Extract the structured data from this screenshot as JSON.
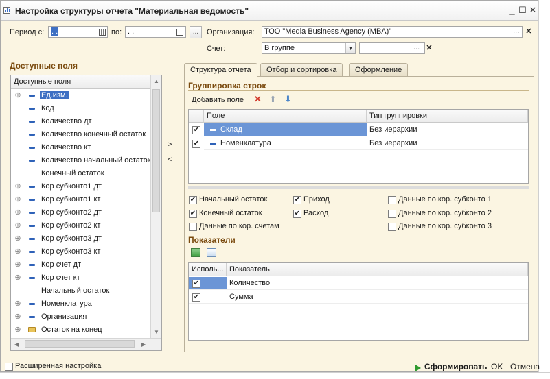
{
  "window": {
    "title": "Настройка структуры отчета \"Материальная ведомость\"",
    "minimize_glyph": "_",
    "maximize_glyph": "☐",
    "close_glyph": "✕"
  },
  "period": {
    "label": "Период с:",
    "from_value": " .  . ",
    "to_label": "по:",
    "to_value": " .  . ",
    "more_button": "..."
  },
  "organization": {
    "label": "Организация:",
    "value": "ТОО \"Media Business Agency (MBA)\"",
    "select_button": "...",
    "clear_glyph": "✕"
  },
  "account": {
    "label": "Счет:",
    "mode_value": "В группе",
    "value": "",
    "select_button": "...",
    "clear_glyph": "✕"
  },
  "available_fields": {
    "section_title": "Доступные поля",
    "column_header": "Доступные поля",
    "items": [
      {
        "label": "Ед.изм.",
        "expandable": true,
        "icon": "field-icon",
        "selected": true
      },
      {
        "label": "Код",
        "expandable": false,
        "icon": "field-icon",
        "selected": false
      },
      {
        "label": "Количество дт",
        "expandable": false,
        "icon": "field-icon",
        "selected": false
      },
      {
        "label": "Количество конечный остаток",
        "expandable": false,
        "icon": "field-icon",
        "selected": false
      },
      {
        "label": "Количество кт",
        "expandable": false,
        "icon": "field-icon",
        "selected": false
      },
      {
        "label": "Количество начальный остаток",
        "expandable": false,
        "icon": "field-icon",
        "selected": false
      },
      {
        "label": "Конечный остаток",
        "expandable": false,
        "icon": "none",
        "selected": false
      },
      {
        "label": "Кор субконто1 дт",
        "expandable": true,
        "icon": "field-icon",
        "selected": false
      },
      {
        "label": "Кор субконто1 кт",
        "expandable": true,
        "icon": "field-icon",
        "selected": false
      },
      {
        "label": "Кор субконто2 дт",
        "expandable": true,
        "icon": "field-icon",
        "selected": false
      },
      {
        "label": "Кор субконто2 кт",
        "expandable": true,
        "icon": "field-icon",
        "selected": false
      },
      {
        "label": "Кор субконто3 дт",
        "expandable": true,
        "icon": "field-icon",
        "selected": false
      },
      {
        "label": "Кор субконто3 кт",
        "expandable": true,
        "icon": "field-icon",
        "selected": false
      },
      {
        "label": "Кор счет дт",
        "expandable": true,
        "icon": "field-icon",
        "selected": false
      },
      {
        "label": "Кор счет кт",
        "expandable": true,
        "icon": "field-icon",
        "selected": false
      },
      {
        "label": "Начальный остаток",
        "expandable": false,
        "icon": "none",
        "selected": false
      },
      {
        "label": "Номенклатура",
        "expandable": true,
        "icon": "field-icon",
        "selected": false
      },
      {
        "label": "Организация",
        "expandable": true,
        "icon": "field-icon",
        "selected": false
      },
      {
        "label": "Остаток на конец",
        "expandable": true,
        "icon": "folder-icon",
        "selected": false
      }
    ],
    "move_right_glyph": ">",
    "move_left_glyph": "<"
  },
  "tabs": [
    {
      "label": "Структура отчета",
      "active": true
    },
    {
      "label": "Отбор и сортировка",
      "active": false
    },
    {
      "label": "Оформление",
      "active": false
    }
  ],
  "grouping": {
    "section_title": "Группировка строк",
    "add_field_button": "Добавить поле",
    "columns": [
      "Поле",
      "Тип группировки"
    ],
    "rows": [
      {
        "checked": true,
        "field": "Склад",
        "type": "Без иерархии",
        "selected": true
      },
      {
        "checked": true,
        "field": "Номенклатура",
        "type": "Без иерархии",
        "selected": false
      }
    ]
  },
  "options": [
    {
      "label": "Начальный остаток",
      "checked": true
    },
    {
      "label": "Конечный остаток",
      "checked": true
    },
    {
      "label": "Данные по кор. счетам",
      "checked": false
    },
    {
      "label": "Приход",
      "checked": true
    },
    {
      "label": "Расход",
      "checked": true
    },
    {
      "label": "Данные по кор. субконто 1",
      "checked": false
    },
    {
      "label": "Данные по кор. субконто 2",
      "checked": false
    },
    {
      "label": "Данные по кор. субконто 3",
      "checked": false
    }
  ],
  "indicators": {
    "section_title": "Показатели",
    "columns": [
      "Исполь...",
      "Показатель"
    ],
    "rows": [
      {
        "checked": true,
        "label": "Количество",
        "selected": true
      },
      {
        "checked": true,
        "label": "Сумма",
        "selected": false
      }
    ]
  },
  "footer": {
    "advanced_label": "Расширенная настройка",
    "advanced_checked": false,
    "generate_button": "Сформировать",
    "ok_button": "OK",
    "cancel_button": "Отмена"
  },
  "colors": {
    "dialog_bg": "#fbf5e2",
    "selection": "#3d6fc3",
    "section_title": "#7a4a0e",
    "generate_green": "#2f9a2f"
  }
}
